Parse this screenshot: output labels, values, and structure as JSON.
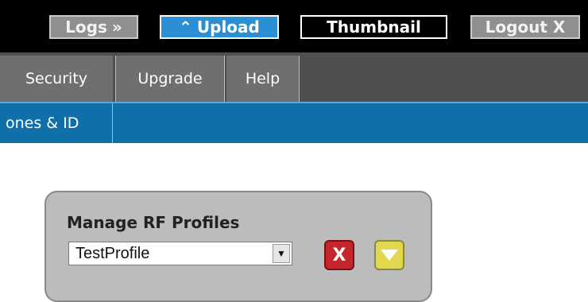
{
  "topbar": {
    "logs_label": "Logs",
    "logs_icon": "double-chevron-right-icon",
    "upload_label": "Upload",
    "upload_icon": "double-chevron-up-icon",
    "thumbnail_label": "Thumbnail",
    "logout_label": "Logout X"
  },
  "menu": {
    "items": [
      {
        "label": "Security"
      },
      {
        "label": "Upgrade"
      },
      {
        "label": "Help"
      }
    ]
  },
  "subnav": {
    "item_label": "ones & ID"
  },
  "panel": {
    "title": "Manage RF Profiles",
    "profile_select_value": "TestProfile",
    "delete_icon": "x-icon",
    "expand_icon": "triangle-down-icon"
  },
  "colors": {
    "topbar_bg": "#000000",
    "menubar_bg": "#4f4f4f",
    "subnav_bg": "#0f6fa8",
    "panel_bg": "#bcbcbc",
    "upload_bg": "#2b8fd6",
    "delete_red": "#c4262b",
    "expand_yellow": "#e2d74e"
  }
}
